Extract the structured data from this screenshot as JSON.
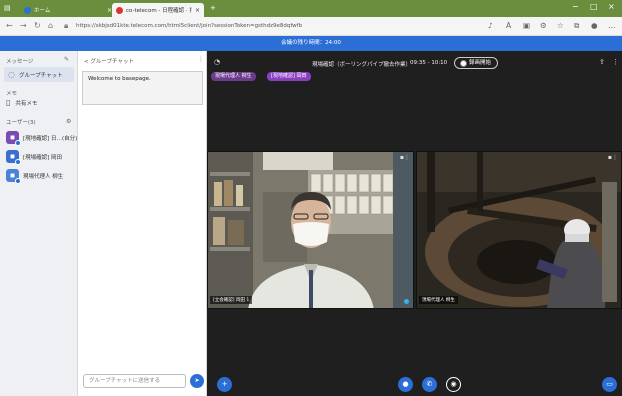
{
  "browser": {
    "tab_inactive_title": "ホーム",
    "tab_active_title": "co-telecom - 日程確認 · 打",
    "url": "https://skbjsd01kte.telecom.com/html5client/join?sessionToken=gsthdz9e8dqfwfb",
    "accent": "#6b8e3e"
  },
  "banner": {
    "text": "会議の残り時間：24:00",
    "color": "#2b6fd6"
  },
  "sidebar": {
    "header": "メッセージ",
    "group_chat": "グループチャット",
    "memo_section": "メモ",
    "memo_item": "共有メモ",
    "users_section": "ユーザー(3)",
    "users": [
      {
        "name": "[現地確認] 日…(自分)",
        "color": "#7a4bb5"
      },
      {
        "name": "[現場確認] 岡田",
        "color": "#3a6fd0"
      },
      {
        "name": "現場代理人 柳生",
        "color": "#4a82d8"
      }
    ]
  },
  "chat": {
    "header": "< グループチャット",
    "welcome": "Welcome to basepage.",
    "input_placeholder": "グループチャットに送信する",
    "send_icon": "send-icon"
  },
  "meeting": {
    "title": "現場確認（ボーリングパイプ撤去作業）",
    "time": "09:35 - 10:10",
    "record_label": "録画開始",
    "chips": [
      "現場代理人 柳生",
      "[現地確認] 岡田"
    ],
    "tiles": [
      {
        "label": "[立会確認] 岡田 1"
      },
      {
        "label": "現場代理人 柳生"
      }
    ]
  }
}
